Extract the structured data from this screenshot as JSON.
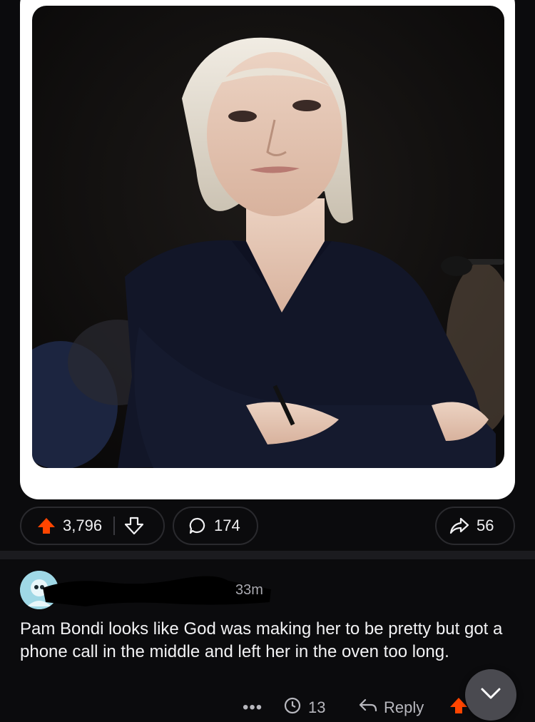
{
  "post": {
    "image_alt": "Photo of a blonde woman in a dark blazer with arms crossed",
    "upvote_count": "3,796",
    "comment_count": "174",
    "share_count": "56"
  },
  "comment": {
    "timestamp": "33m",
    "body": "Pam Bondi looks like God was making her to be pretty but got a phone call in the middle and left her in the oven too long.",
    "more_label": "•••",
    "vote_count": "13",
    "reply_label": "Reply"
  },
  "colors": {
    "accent_upvote": "#ff4500",
    "background": "#0b0b0d",
    "pill_border": "#2a2a2e",
    "avatar": "#9fd8e6"
  },
  "icons": {
    "upvote": "upvote-arrow-icon",
    "downvote": "downvote-arrow-icon",
    "comments": "speech-bubble-icon",
    "share": "share-arrow-icon",
    "comment_votes": "clock-arrow-icon",
    "reply": "reply-arrow-icon",
    "scroll": "chevron-down-icon"
  }
}
